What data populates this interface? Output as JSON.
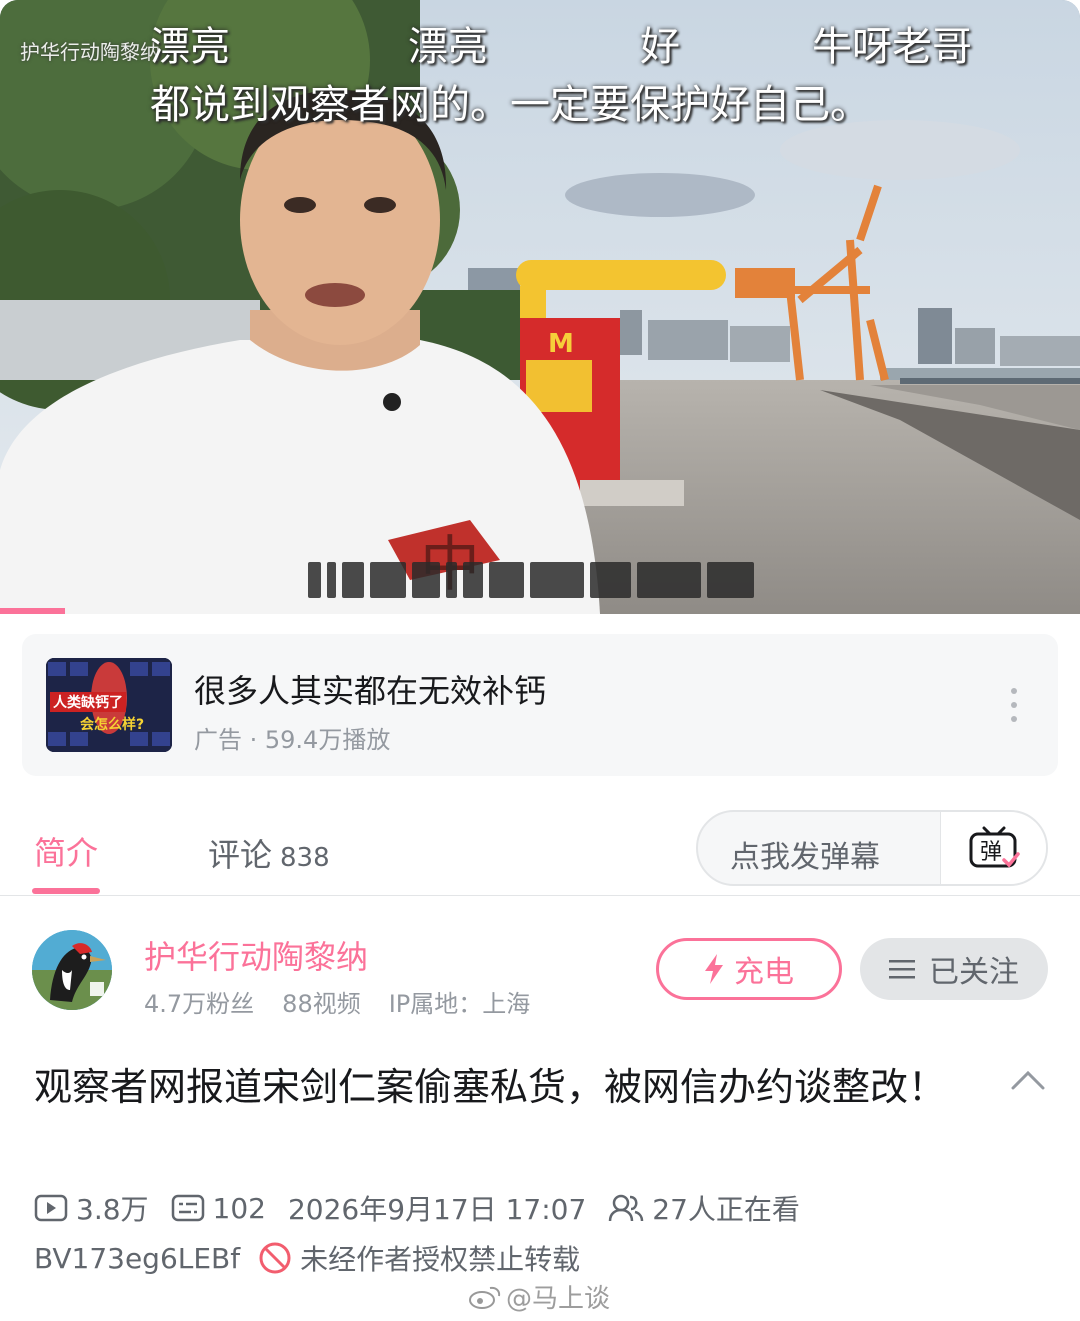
{
  "video": {
    "top_left_watermark": "护华行动陶黎纳",
    "danmaku": [
      "漂亮",
      "漂亮",
      "好",
      "牛呀老哥",
      "都说到观察者网的。一定要保护好自己。"
    ],
    "subtitle_hidden": true
  },
  "ad": {
    "thumb_text_1": "人类缺钙了",
    "thumb_text_2": "会怎么样?",
    "title": "很多人其实都在无效补钙",
    "meta": "广告 · 59.4万播放"
  },
  "tabs": {
    "intro_label": "简介",
    "comment_label": "评论",
    "comment_count": "838",
    "danmaku_placeholder": "点我发弹幕",
    "danmaku_icon_text": "弹"
  },
  "uploader": {
    "name": "护华行动陶黎纳",
    "fans": "4.7万粉丝",
    "videos": "88视频",
    "ip": "IP属地：上海",
    "charge_label": "充电",
    "follow_label": "已关注"
  },
  "video_info": {
    "title": "观察者网报道宋剑仁案偷塞私货，被网信办约谈整改！",
    "plays": "3.8万",
    "danmaku_count": "102",
    "datetime": "2026年9月17日 17:07",
    "watching": "27人正在看",
    "bvid": "BV173eg6LEBf",
    "notice": "未经作者授权禁止转载"
  },
  "watermark": "@马上谈",
  "colors": {
    "accent": "#fb7299",
    "text_primary": "#18191c",
    "text_secondary": "#61666d",
    "text_muted": "#9499a0"
  },
  "progress_fraction": 0.06
}
